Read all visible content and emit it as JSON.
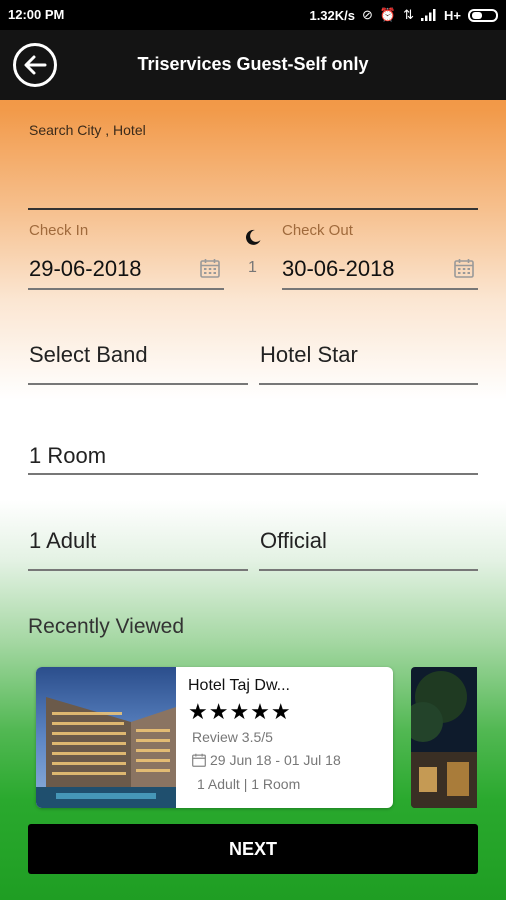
{
  "status_bar": {
    "time": "12:00 PM",
    "speed": "1.32K/s",
    "network": "H+"
  },
  "app_bar": {
    "title": "Triservices Guest-Self only"
  },
  "search": {
    "placeholder": "Search City , Hotel"
  },
  "check_in": {
    "label": "Check In",
    "value": "29-06-2018"
  },
  "check_out": {
    "label": "Check Out",
    "value": "30-06-2018"
  },
  "nights": "1",
  "band": {
    "value": "Select Band"
  },
  "hotel_star": {
    "value": "Hotel Star"
  },
  "rooms": {
    "value": "1 Room"
  },
  "adults": {
    "value": "1 Adult"
  },
  "purpose": {
    "value": "Official"
  },
  "recently_viewed": {
    "title": "Recently Viewed",
    "items": [
      {
        "name": "Hotel Taj Dw...",
        "stars": "★★★★★",
        "review": "Review 3.5/5",
        "dates": "29 Jun 18 - 01 Jul 18",
        "guests": "1 Adult | 1 Room"
      }
    ]
  },
  "next_button": {
    "label": "NEXT"
  },
  "colors": {
    "saffron": "#f08a2e",
    "green": "#2aa92e",
    "app_bar": "#141414"
  }
}
